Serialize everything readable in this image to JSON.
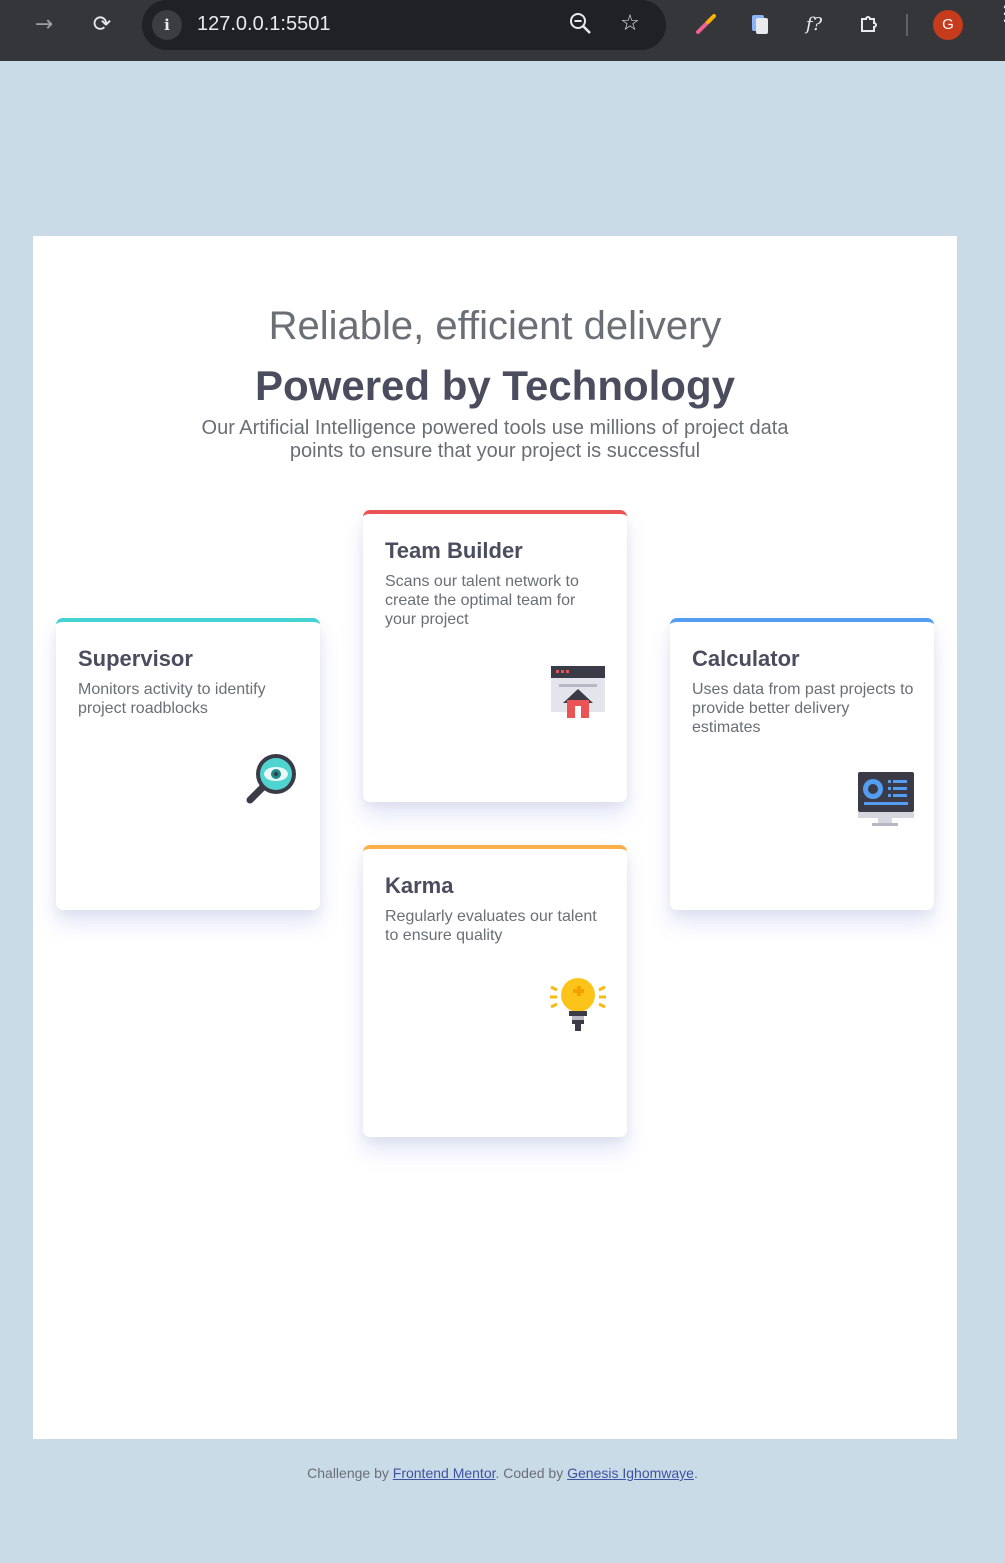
{
  "browser": {
    "url": "127.0.0.1:5501",
    "avatar_letter": "G"
  },
  "header": {
    "title_light": "Reliable, efficient delivery",
    "title_bold": "Powered by Technology",
    "intro": "Our Artificial Intelligence powered tools use millions of project data points to ensure that your project is successful"
  },
  "cards": [
    {
      "title": "Supervisor",
      "description": "Monitors activity to identify project roadblocks",
      "accent": "#44d3d2",
      "icon": "magnifier-eye-icon"
    },
    {
      "title": "Team Builder",
      "description": "Scans our talent network to create the optimal team for your project",
      "accent": "#ea5454",
      "icon": "browser-house-icon"
    },
    {
      "title": "Karma",
      "description": "Regularly evaluates our talent to ensure quality",
      "accent": "#fcae4a",
      "icon": "lightbulb-icon"
    },
    {
      "title": "Calculator",
      "description": "Uses data from past projects to provide better delivery estimates",
      "accent": "#549ef2",
      "icon": "monitor-dashboard-icon"
    }
  ],
  "footer": {
    "prefix": "Challenge by",
    "link1": "Frontend Mentor",
    "middle": ". Coded by",
    "link2": "Genesis Ighomwaye",
    "suffix": "."
  }
}
